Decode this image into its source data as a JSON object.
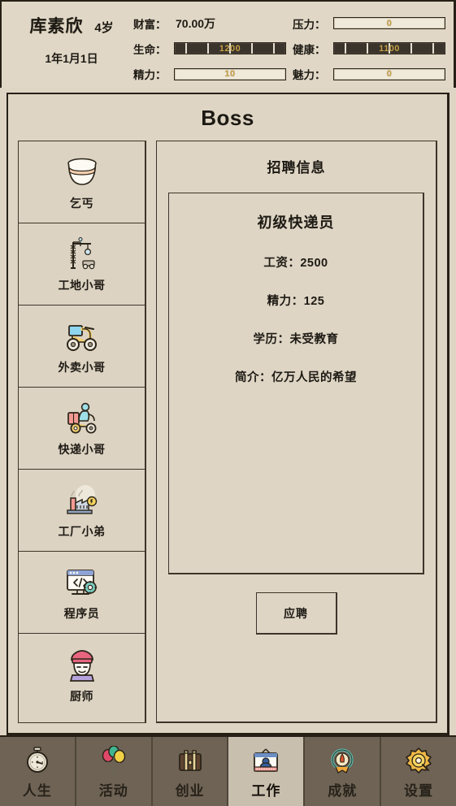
{
  "status": {
    "name": "库素欣",
    "age": "4岁",
    "date": "1年1月1日",
    "stats": [
      {
        "label": "财富：",
        "kind": "text",
        "value": "70.00万"
      },
      {
        "label": "压力：",
        "kind": "bar",
        "value": "0",
        "filled": false
      },
      {
        "label": "生命：",
        "kind": "bar",
        "value": "1200",
        "filled": true
      },
      {
        "label": "健康：",
        "kind": "bar",
        "value": "1100",
        "filled": true
      },
      {
        "label": "精力：",
        "kind": "bar",
        "value": "10",
        "filled": false
      },
      {
        "label": "魅力：",
        "kind": "bar",
        "value": "0",
        "filled": false
      }
    ]
  },
  "window": {
    "title": "Boss",
    "detail_heading": "招聘信息"
  },
  "job_list": [
    {
      "label": "乞丐",
      "icon": "begging-bowl-icon"
    },
    {
      "label": "工地小哥",
      "icon": "construction-crane-icon"
    },
    {
      "label": "外卖小哥",
      "icon": "delivery-scooter-icon"
    },
    {
      "label": "快递小哥",
      "icon": "courier-scooter-icon"
    },
    {
      "label": "工厂小弟",
      "icon": "factory-icon"
    },
    {
      "label": "程序员",
      "icon": "code-monitor-icon"
    },
    {
      "label": "厨师",
      "icon": "chef-icon"
    }
  ],
  "job_detail": {
    "title": "初级快递员",
    "attributes": [
      "工资：2500",
      "精力：125",
      "学历：未受教育",
      "简介：亿万人民的希望"
    ],
    "apply_label": "应聘"
  },
  "bottom_nav": [
    {
      "label": "人生",
      "icon": "stopwatch-icon",
      "active": false
    },
    {
      "label": "活动",
      "icon": "balloons-icon",
      "active": false
    },
    {
      "label": "创业",
      "icon": "briefcase-icon",
      "active": false
    },
    {
      "label": "工作",
      "icon": "id-card-icon",
      "active": true
    },
    {
      "label": "成就",
      "icon": "achievement-wreath-icon",
      "active": false
    },
    {
      "label": "设置",
      "icon": "gear-icon",
      "active": false
    }
  ],
  "colors": {
    "panel_bg": "#ded5c4",
    "border": "#262017",
    "nav_bg": "#6e6354",
    "nav_active_bg": "#c9bfae",
    "bar_value": "#c8a249",
    "bar_full_bg": "#3a342c"
  }
}
